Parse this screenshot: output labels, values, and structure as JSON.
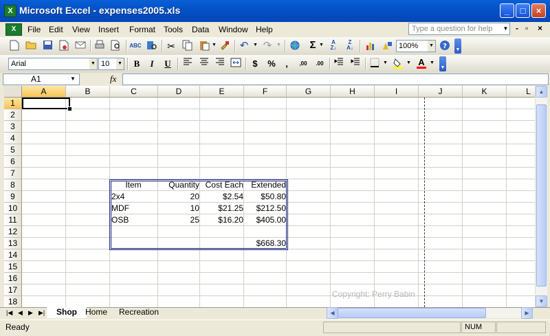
{
  "window": {
    "title": "Microsoft Excel - expenses2005.xls",
    "app_icon": "X",
    "minimize": "_",
    "maximize": "□",
    "close": "×"
  },
  "menu": {
    "items": [
      "File",
      "Edit",
      "View",
      "Insert",
      "Format",
      "Tools",
      "Data",
      "Window",
      "Help"
    ],
    "help_placeholder": "Type a question for help",
    "mdi_minimize": "-",
    "mdi_restore": "▫",
    "mdi_close": "×"
  },
  "toolbar": {
    "zoom": "100%",
    "sum_icon": "Σ",
    "font_name": "Arial",
    "font_size": "10",
    "bold": "B",
    "italic": "I",
    "underline": "U",
    "currency": "$",
    "percent": "%",
    "inc_decimal": ",00",
    "dec_decimal": ".00",
    "font_color_letter": "A",
    "fill_color": "#ffff00",
    "font_color": "#ff0000"
  },
  "formula_bar": {
    "name_box": "A1",
    "fx": "fx",
    "value": ""
  },
  "grid": {
    "columns": [
      "A",
      "B",
      "C",
      "D",
      "E",
      "F",
      "G",
      "H",
      "I",
      "J",
      "K",
      "L"
    ],
    "rows": [
      "1",
      "2",
      "3",
      "4",
      "5",
      "6",
      "7",
      "8",
      "9",
      "10",
      "11",
      "12",
      "13",
      "14",
      "15",
      "16",
      "17",
      "18"
    ],
    "table": {
      "headers": [
        "Item",
        "Quantity",
        "Cost Each",
        "Extended"
      ],
      "rows": [
        [
          "2x4",
          "20",
          "$2.54",
          "$50.80"
        ],
        [
          "MDF",
          "10",
          "$21.25",
          "$212.50"
        ],
        [
          "OSB",
          "25",
          "$16.20",
          "$405.00"
        ]
      ],
      "total": "$668.30"
    },
    "watermark": "Copyright: Perry Babin"
  },
  "sheets": {
    "tabs": [
      "Shop",
      "Home",
      "Recreation"
    ],
    "active": "Shop"
  },
  "status": {
    "text": "Ready",
    "num": "NUM"
  }
}
